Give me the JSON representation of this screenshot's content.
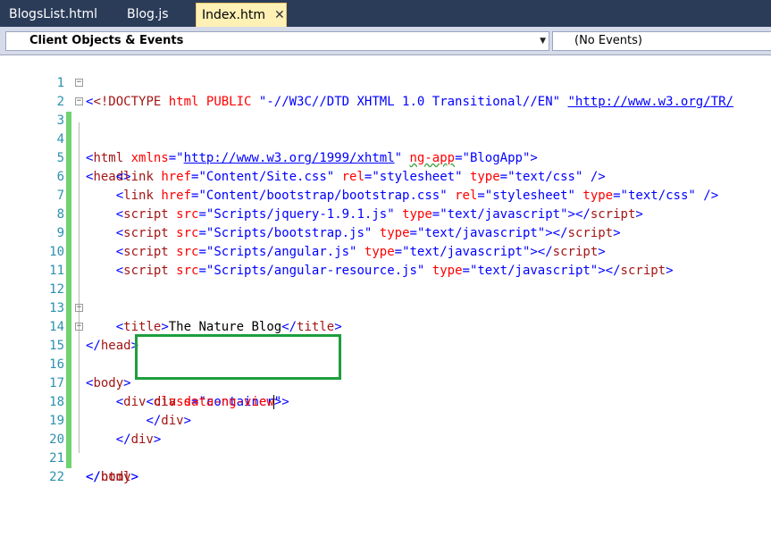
{
  "tabs": [
    {
      "label": "BlogsList.html",
      "active": false
    },
    {
      "label": "Blog.js",
      "active": false
    },
    {
      "label": "Index.htm",
      "active": true
    }
  ],
  "tab_close_glyph": "✕",
  "navbar": {
    "objects_label": "Client Objects & Events",
    "events_label": "(No Events)"
  },
  "colors": {
    "tabbar_bg": "#2b3c59",
    "active_tab_bg": "#fff1b5",
    "line_numbers": "#2b91af",
    "tag": "#a31515",
    "attribute": "#ff0000",
    "value": "#0000ff",
    "highlight_box": "#1e9e3c",
    "change_marker": "#6fd36f"
  },
  "line_numbers": [
    "1",
    "2",
    "3",
    "4",
    "5",
    "6",
    "7",
    "8",
    "9",
    "10",
    "11",
    "12",
    "13",
    "14",
    "15",
    "16",
    "17",
    "18",
    "19",
    "20",
    "21",
    "22"
  ],
  "code": {
    "l1_doctype": "<!DOCTYPE",
    "l1_html": "html",
    "l1_public": "PUBLIC",
    "l1_fpi": "\"-//W3C//DTD XHTML 1.0 Transitional//EN\"",
    "l1_url": "\"http://www.w3.org/TR/",
    "l2_xmlns_val": "http://www.w3.org/1999/xhtml",
    "l2_ngapp_val": "\"BlogApp\"",
    "l4_href": "\"Content/Site.css\"",
    "l4_rel": "\"stylesheet\"",
    "l4_type": "\"text/css\"",
    "l5_href": "\"Content/bootstrap/bootstrap.css\"",
    "l5_rel": "\"stylesheet\"",
    "l5_type": "\"text/css\"",
    "l6_src": "\"Scripts/jquery-1.9.1.js\"",
    "l7_src": "\"Scripts/bootstrap.js\"",
    "l8_src": "\"Scripts/angular.js\"",
    "l9_src": "\"Scripts/angular-resource.js\"",
    "js_type": "\"text/javascript\"",
    "l12_title": "The Nature Blog",
    "l15_class": "\"container\"",
    "l16_attr": "data-ng-view"
  },
  "icons": {
    "fold_collapse": "collapse-icon",
    "dropdown": "chevron-down-icon"
  }
}
